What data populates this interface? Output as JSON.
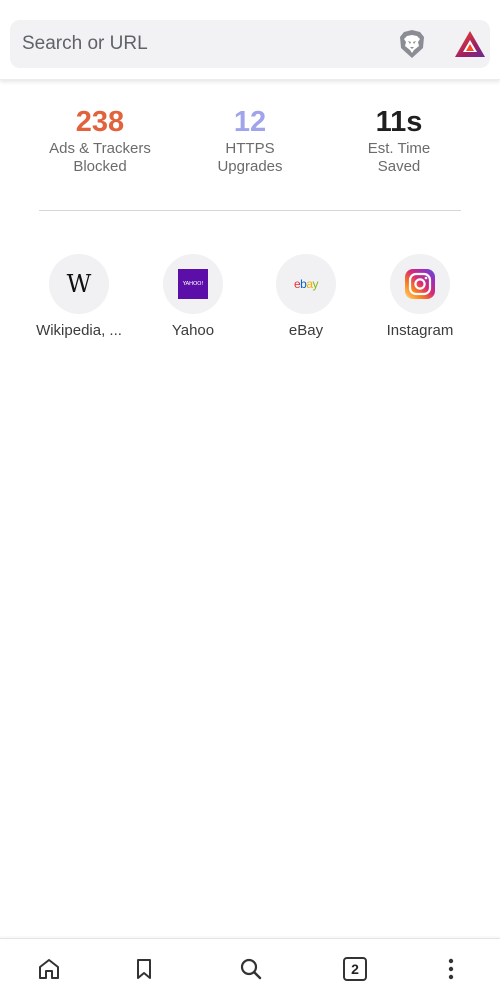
{
  "search": {
    "placeholder": "Search or URL"
  },
  "stats": {
    "ads": {
      "value": "238",
      "label_line1": "Ads & Trackers",
      "label_line2": "Blocked",
      "color": "#e2623c"
    },
    "https": {
      "value": "12",
      "label_line1": "HTTPS",
      "label_line2": "Upgrades",
      "color": "#a0a5eb"
    },
    "time": {
      "value": "11s",
      "label_line1": "Est. Time",
      "label_line2": "Saved",
      "color": "#1f1f1f"
    }
  },
  "top_sites": [
    {
      "label": "Wikipedia, ...",
      "icon": "wikipedia-icon",
      "glyph": "W"
    },
    {
      "label": "Yahoo",
      "icon": "yahoo-icon",
      "glyph": "YAHOO!"
    },
    {
      "label": "eBay",
      "icon": "ebay-icon"
    },
    {
      "label": "Instagram",
      "icon": "instagram-icon"
    }
  ],
  "ebay_logo": {
    "e": "e",
    "b": "b",
    "a": "a",
    "y": "y"
  },
  "bottom_nav": {
    "tab_count": "2",
    "icons": [
      "home-icon",
      "bookmark-icon",
      "search-icon",
      "tabs-icon",
      "menu-icon"
    ]
  },
  "colors": {
    "search_bg": "#f2f2f4",
    "brave_orange": "#fb542b",
    "bat_red": "#ff4724",
    "bat_purple": "#662d91",
    "yahoo_purple": "#5b0fa8"
  }
}
